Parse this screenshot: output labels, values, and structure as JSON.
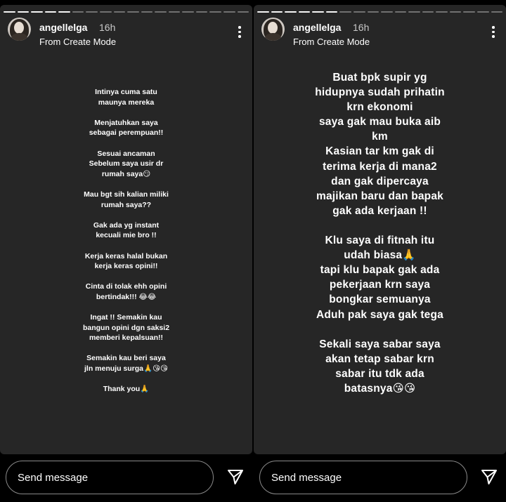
{
  "stories": [
    {
      "username": "angellelga",
      "time": "16h",
      "subline": "From Create Mode",
      "paragraphs": [
        [
          "Intinya cuma satu",
          "maunya mereka"
        ],
        [
          "Menjatuhkan saya",
          "sebagai perempuan!!"
        ],
        [
          "Sesuai ancaman",
          "Sebelum saya usir dr",
          "rumah saya😏"
        ],
        [
          "Mau bgt sih kalian miliki",
          "rumah saya??"
        ],
        [
          "Gak ada yg instant",
          "kecuali mie bro !!"
        ],
        [
          "Kerja keras halal bukan",
          "kerja keras opini!!"
        ],
        [
          "Cinta di tolak ehh opini",
          "bertindak!!! 😂😂"
        ],
        [
          "Ingat  !! Semakin kau",
          "bangun opini dgn saksi2",
          "memberi kepalsuan!!"
        ],
        [
          "Semakin kau beri saya",
          "jln menuju surga🙏😘😘"
        ],
        [
          "Thank you🙏"
        ]
      ],
      "message_placeholder": "Send message"
    },
    {
      "username": "angellelga",
      "time": "16h",
      "subline": "From Create Mode",
      "paragraphs": [
        [
          "Buat bpk supir  yg",
          "hidupnya sudah prihatin",
          "krn ekonomi",
          "saya gak mau buka aib",
          "km",
          "Kasian tar km gak di",
          "terima kerja di mana2",
          "dan gak dipercaya",
          "majikan baru dan bapak",
          "gak ada kerjaan !!"
        ],
        [
          "Klu saya di fitnah itu",
          "udah biasa🙏",
          "tapi klu bapak gak ada",
          "pekerjaan krn saya",
          "bongkar semuanya",
          "Aduh pak saya gak tega"
        ],
        [
          "Sekali saya sabar saya",
          "akan tetap sabar krn",
          "sabar itu tdk ada",
          "batasnya😘😘"
        ]
      ],
      "message_placeholder": "Send message"
    }
  ],
  "icons": {
    "more": "more-vertical-icon",
    "send": "send-paper-plane-icon"
  },
  "progress": {
    "left": {
      "segments": 18,
      "done": 5
    },
    "right": {
      "segments": 18,
      "done": 6
    }
  }
}
